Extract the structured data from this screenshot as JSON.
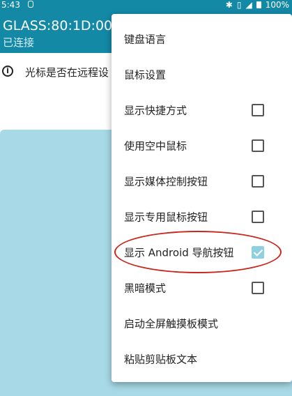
{
  "status_bar": {
    "time": "5:43",
    "icons": [
      "bluetooth-icon",
      "vibrate-icon",
      "no-signal-icon",
      "battery-icon"
    ],
    "battery": "100%"
  },
  "header": {
    "device_name": "GLASS:80:1D:00",
    "status": "已连接"
  },
  "notice": {
    "icon": "info-icon",
    "text": "光标是否在远程设"
  },
  "menu": {
    "items": [
      {
        "label": "键盘语言"
      },
      {
        "label": "鼠标设置"
      },
      {
        "label": "显示快捷方式",
        "checked": false
      },
      {
        "label": "使用空中鼠标",
        "checked": false
      },
      {
        "label": "显示媒体控制按钮",
        "checked": false
      },
      {
        "label": "显示专用鼠标按钮",
        "checked": false
      },
      {
        "label": "显示 Android 导航按钮",
        "checked": true
      },
      {
        "label": "黑暗模式",
        "checked": false
      },
      {
        "label": "启动全屏触摸板模式"
      },
      {
        "label": "粘贴剪贴板文本"
      }
    ]
  },
  "colors": {
    "app_bar": "#1389a6",
    "touchpad": "#a7d9e6",
    "checked": "#8fd0e0",
    "annotation": "#c8271e"
  }
}
